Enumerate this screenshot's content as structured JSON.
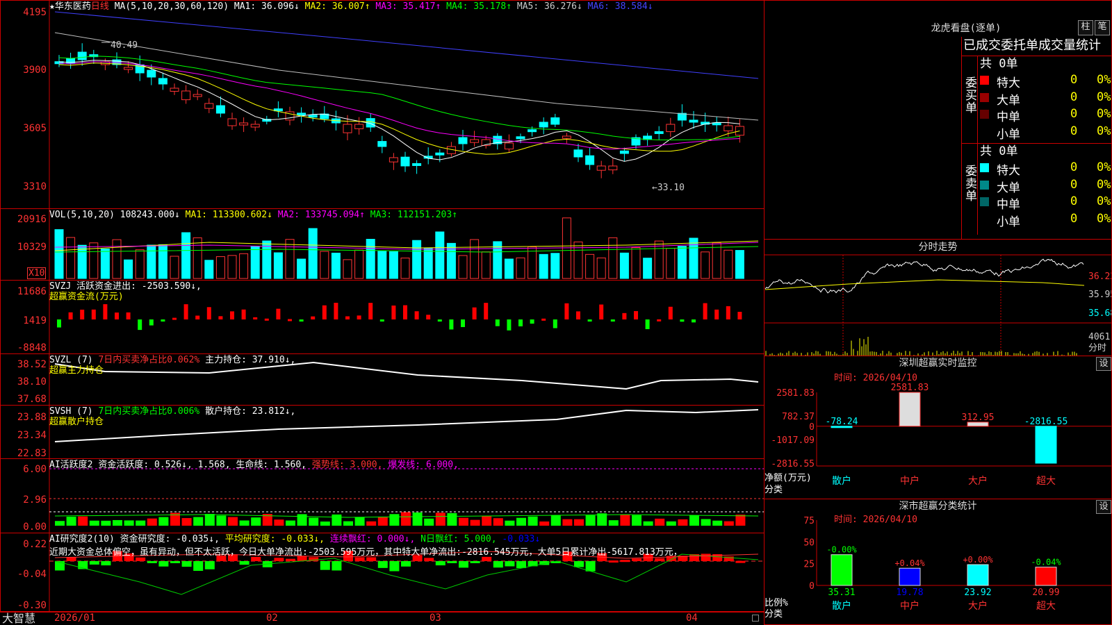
{
  "stock": {
    "star": "★",
    "name": "华东医药",
    "period": "日线"
  },
  "kline": {
    "ma_params": "MA(5,10,20,30,60,120)",
    "ma1": "MA1: 36.096↓",
    "ma2": "MA2: 36.007↑",
    "ma3": "MA3: 35.417↑",
    "ma4": "MA4: 35.178↑",
    "ma5": "MA5: 36.276↓",
    "ma6": "MA6: 38.584↓",
    "high_label": "40.49",
    "low_label": "←33.10",
    "y_ticks": [
      "4195",
      "3900",
      "3605",
      "3310"
    ]
  },
  "vol": {
    "params": "VOL(5,10,20)",
    "value": "108243.000↓",
    "ma1": "MA1: 113300.602↓",
    "ma2": "MA2: 133745.094↑",
    "ma3": "MA3: 112151.203↑",
    "y_ticks": [
      "20916",
      "10329"
    ],
    "unit": "X10"
  },
  "svzj": {
    "title": "SVZJ",
    "label": "活跃资金进出: -2503.590↓,",
    "sub": "超赢资金流(万元)",
    "y_ticks": [
      "11686",
      "1419",
      "-8848"
    ]
  },
  "svzl": {
    "title": "SVZL (7)",
    "ratio": "7日内买卖净占比0.062%",
    "hold": "主力持仓: 37.910↓,",
    "sub": "超赢主力持仓",
    "y_ticks": [
      "38.52",
      "38.10",
      "37.68"
    ]
  },
  "svsh": {
    "title": "SVSH (7)",
    "ratio": "7日内买卖净占比0.006%",
    "hold": "散户持仓: 23.812↓,",
    "sub": "超赢散户持仓",
    "y_ticks": [
      "23.88",
      "23.34",
      "22.83"
    ]
  },
  "ai_active": {
    "title": "AI活跃度2",
    "label": "资金活跃度: 0.526↓",
    "v2": "1.568,",
    "life": "生命线: 1.560,",
    "strong": "强势线: 3.000,",
    "burst": "爆发线: 6.000,",
    "y_ticks": [
      "6.00",
      "2.96",
      "0.00"
    ]
  },
  "ai_research": {
    "title": "AI研究度2(10)",
    "label": "资金研究度: -0.035↓,",
    "avg": "平均研究度: -0.033↓,",
    "red": "连续飘红: 0.000↓,",
    "nred": "N日飘红: 5.000,",
    "nred2": "-0.033↓",
    "comment": "近期大资金总体偏空，虽有异动，但不太活跃，今日大单净流出:-2503.595万元，其中特大单净流出:-2816.545万元，大单5日累计净出-5617.813万元，",
    "y_ticks": [
      "0.22",
      "-0.04",
      "-0.30"
    ]
  },
  "xaxis": {
    "brand": "大智慧",
    "dates": [
      "2026/01",
      "02",
      "03",
      "04"
    ]
  },
  "longhu": {
    "title": "龙虎看盘(逐单)",
    "btn_zhu": "柱",
    "btn_bi": "笔",
    "header": "已成交委托单成交量统计",
    "buy_side": "委买单",
    "sell_side": "委卖单",
    "buy_total": "共 0单",
    "sell_total": "共 0单",
    "buy_rows": [
      {
        "label": "特大",
        "count": "0",
        "pct": "0%",
        "color": "#ff0000"
      },
      {
        "label": "大单",
        "count": "0",
        "pct": "0%",
        "color": "#990000"
      },
      {
        "label": "中单",
        "count": "0",
        "pct": "0%",
        "color": "#660000"
      },
      {
        "label": "小单",
        "count": "0",
        "pct": "0%",
        "color": "#000000"
      }
    ],
    "sell_rows": [
      {
        "label": "特大",
        "count": "0",
        "pct": "0%",
        "color": "#00ffff"
      },
      {
        "label": "大单",
        "count": "0",
        "pct": "0%",
        "color": "#008888"
      },
      {
        "label": "中单",
        "count": "0",
        "pct": "0%",
        "color": "#006666"
      },
      {
        "label": "小单",
        "count": "0",
        "pct": "0%",
        "color": "#000000"
      }
    ]
  },
  "fenshi": {
    "title": "分时走势",
    "prices": [
      "36.22",
      "35.95",
      "35.68"
    ],
    "vol_label": "4061",
    "vol_unit": "分时"
  },
  "monitor": {
    "title": "深圳超赢实时监控",
    "btn": "设",
    "time": "时间: 2026/04/10",
    "ylabel": "净额(万元)",
    "xlabel": "分类",
    "y_ticks": [
      "2581.83",
      "782.37",
      "0",
      "-1017.09",
      "-2816.55"
    ],
    "categories": [
      "散户",
      "中户",
      "大户",
      "超大"
    ],
    "values": [
      -78.24,
      2581.83,
      312.95,
      -2816.55
    ],
    "value_labels": [
      "-78.24",
      "2581.83",
      "312.95",
      "-2816.55"
    ]
  },
  "classify": {
    "title": "深市超赢分类统计",
    "btn": "设",
    "time": "时间: 2026/04/10",
    "ylabel": "比例%",
    "xlabel": "分类",
    "y_ticks": [
      "75",
      "50",
      "25",
      "0"
    ],
    "categories": [
      "散户",
      "中户",
      "大户",
      "超大"
    ],
    "values": [
      35.31,
      19.78,
      23.92,
      20.99
    ],
    "value_labels": [
      "35.31",
      "19.78",
      "23.92",
      "20.99"
    ],
    "change_labels": [
      "-0.00%",
      "+0.04%",
      "+0.00%",
      "-0.04%"
    ]
  },
  "chart_data": {
    "type": "bar",
    "title": "深圳超赢实时监控",
    "categories": [
      "散户",
      "中户",
      "大户",
      "超大"
    ],
    "values": [
      -78.24,
      2581.83,
      312.95,
      -2816.55
    ],
    "ylabel": "净额(万元)",
    "xlabel": "分类",
    "ylim": [
      -2816.55,
      2581.83
    ]
  },
  "colors": {
    "up": "#ff3333",
    "down": "#00ffff",
    "ma1": "#ffffff",
    "ma2": "#ffff00",
    "ma3": "#ff00ff",
    "ma4": "#00ff00",
    "ma5": "#c0c0c0",
    "ma6": "#4040ff"
  }
}
